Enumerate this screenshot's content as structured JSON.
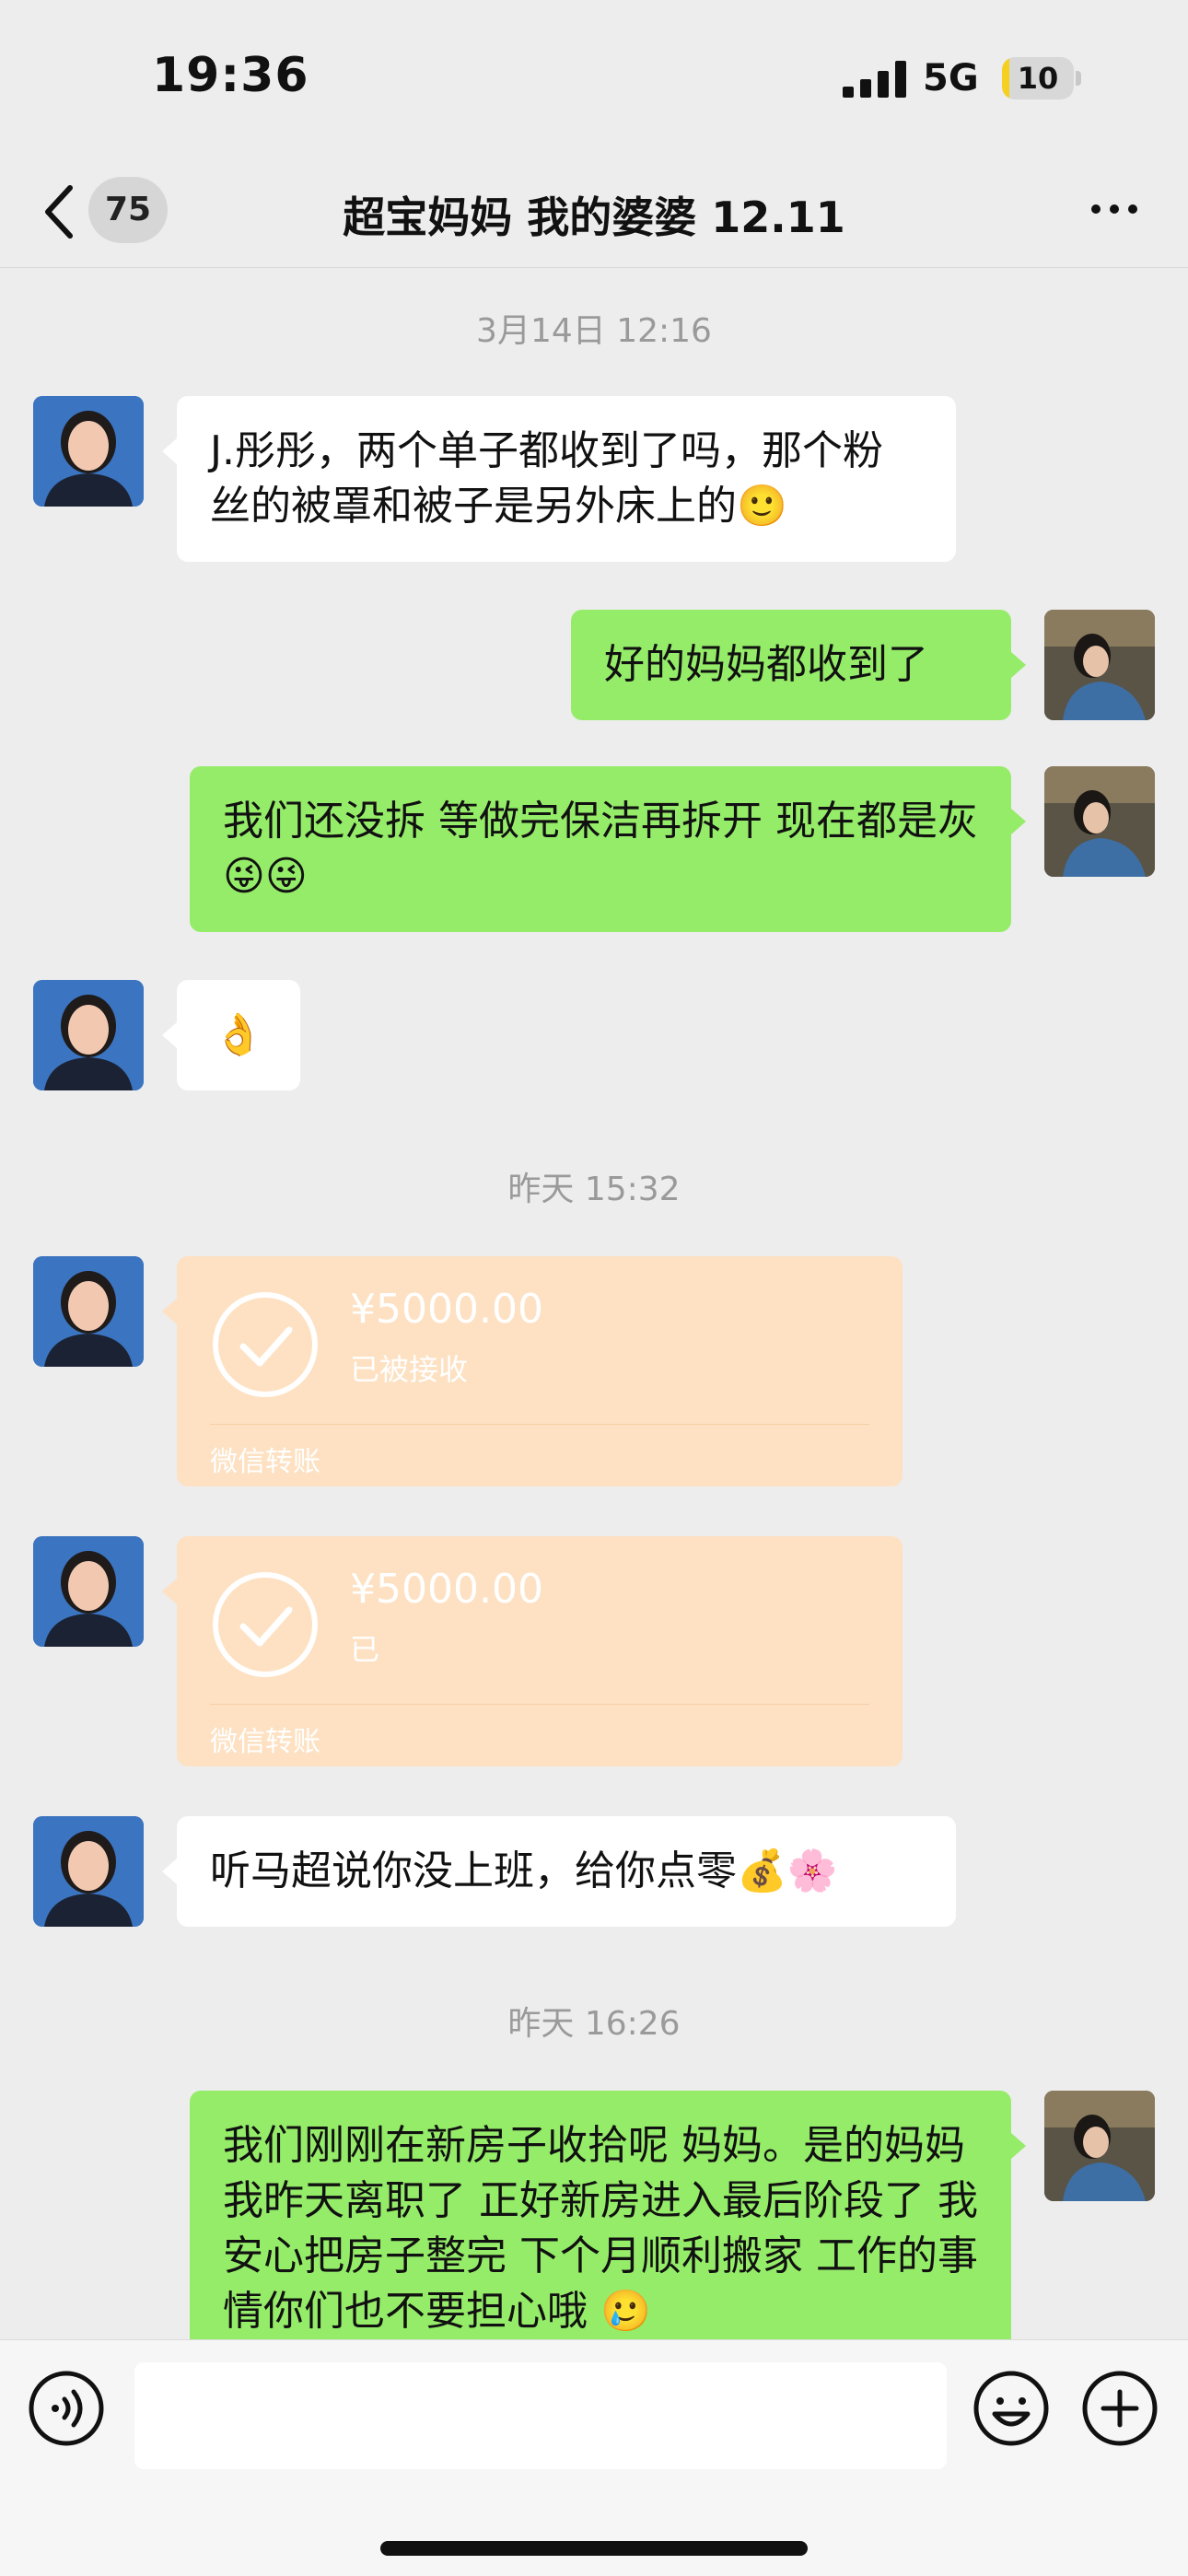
{
  "status_bar": {
    "time": "19:36",
    "network": "5G",
    "battery": "10",
    "battery_level": 0.1
  },
  "nav": {
    "unread_count": "75",
    "title": "超宝妈妈 我的婆婆 12.11",
    "back_icon": "chevron-left-icon",
    "more_icon": "more-dots-icon"
  },
  "timestamps": [
    "3月14日 12:16",
    "昨天 15:32",
    "昨天 16:26"
  ],
  "messages": [
    {
      "from": "mom",
      "text": "J.彤彤，两个单子都收到了吗，那个粉丝的被罩和被子是另外床上的🙂"
    },
    {
      "from": "me",
      "text": "好的妈妈都收到了"
    },
    {
      "from": "me",
      "text": "我们还没拆  等做完保洁再拆开 现在都是灰😜😜"
    },
    {
      "from": "mom",
      "text": "👌"
    },
    {
      "from": "mom",
      "type": "transfer",
      "amount": "¥5000.00",
      "status": "已被接收",
      "label": "微信转账"
    },
    {
      "from": "mom",
      "type": "transfer",
      "amount": "¥5000.00",
      "status": "已",
      "label": "微信转账"
    },
    {
      "from": "mom",
      "text": "听马超说你没上班，给你点零💰🌸"
    },
    {
      "from": "me",
      "text": "我们刚刚在新房子收拾呢 妈妈。是的妈妈 我昨天离职了  正好新房进入最后阶段了  我安心把房子整完 下个月顺利搬家 工作的事情你们也不要担心哦 🥲"
    }
  ],
  "input_bar": {
    "voice_icon": "voice-icon",
    "emoji_icon": "emoji-smile-icon",
    "plus_icon": "plus-circle-icon",
    "placeholder": ""
  },
  "colors": {
    "background": "#ededed",
    "sent_bubble": "#95ec69",
    "received_bubble": "#ffffff",
    "transfer_card": "#fde1c2"
  }
}
